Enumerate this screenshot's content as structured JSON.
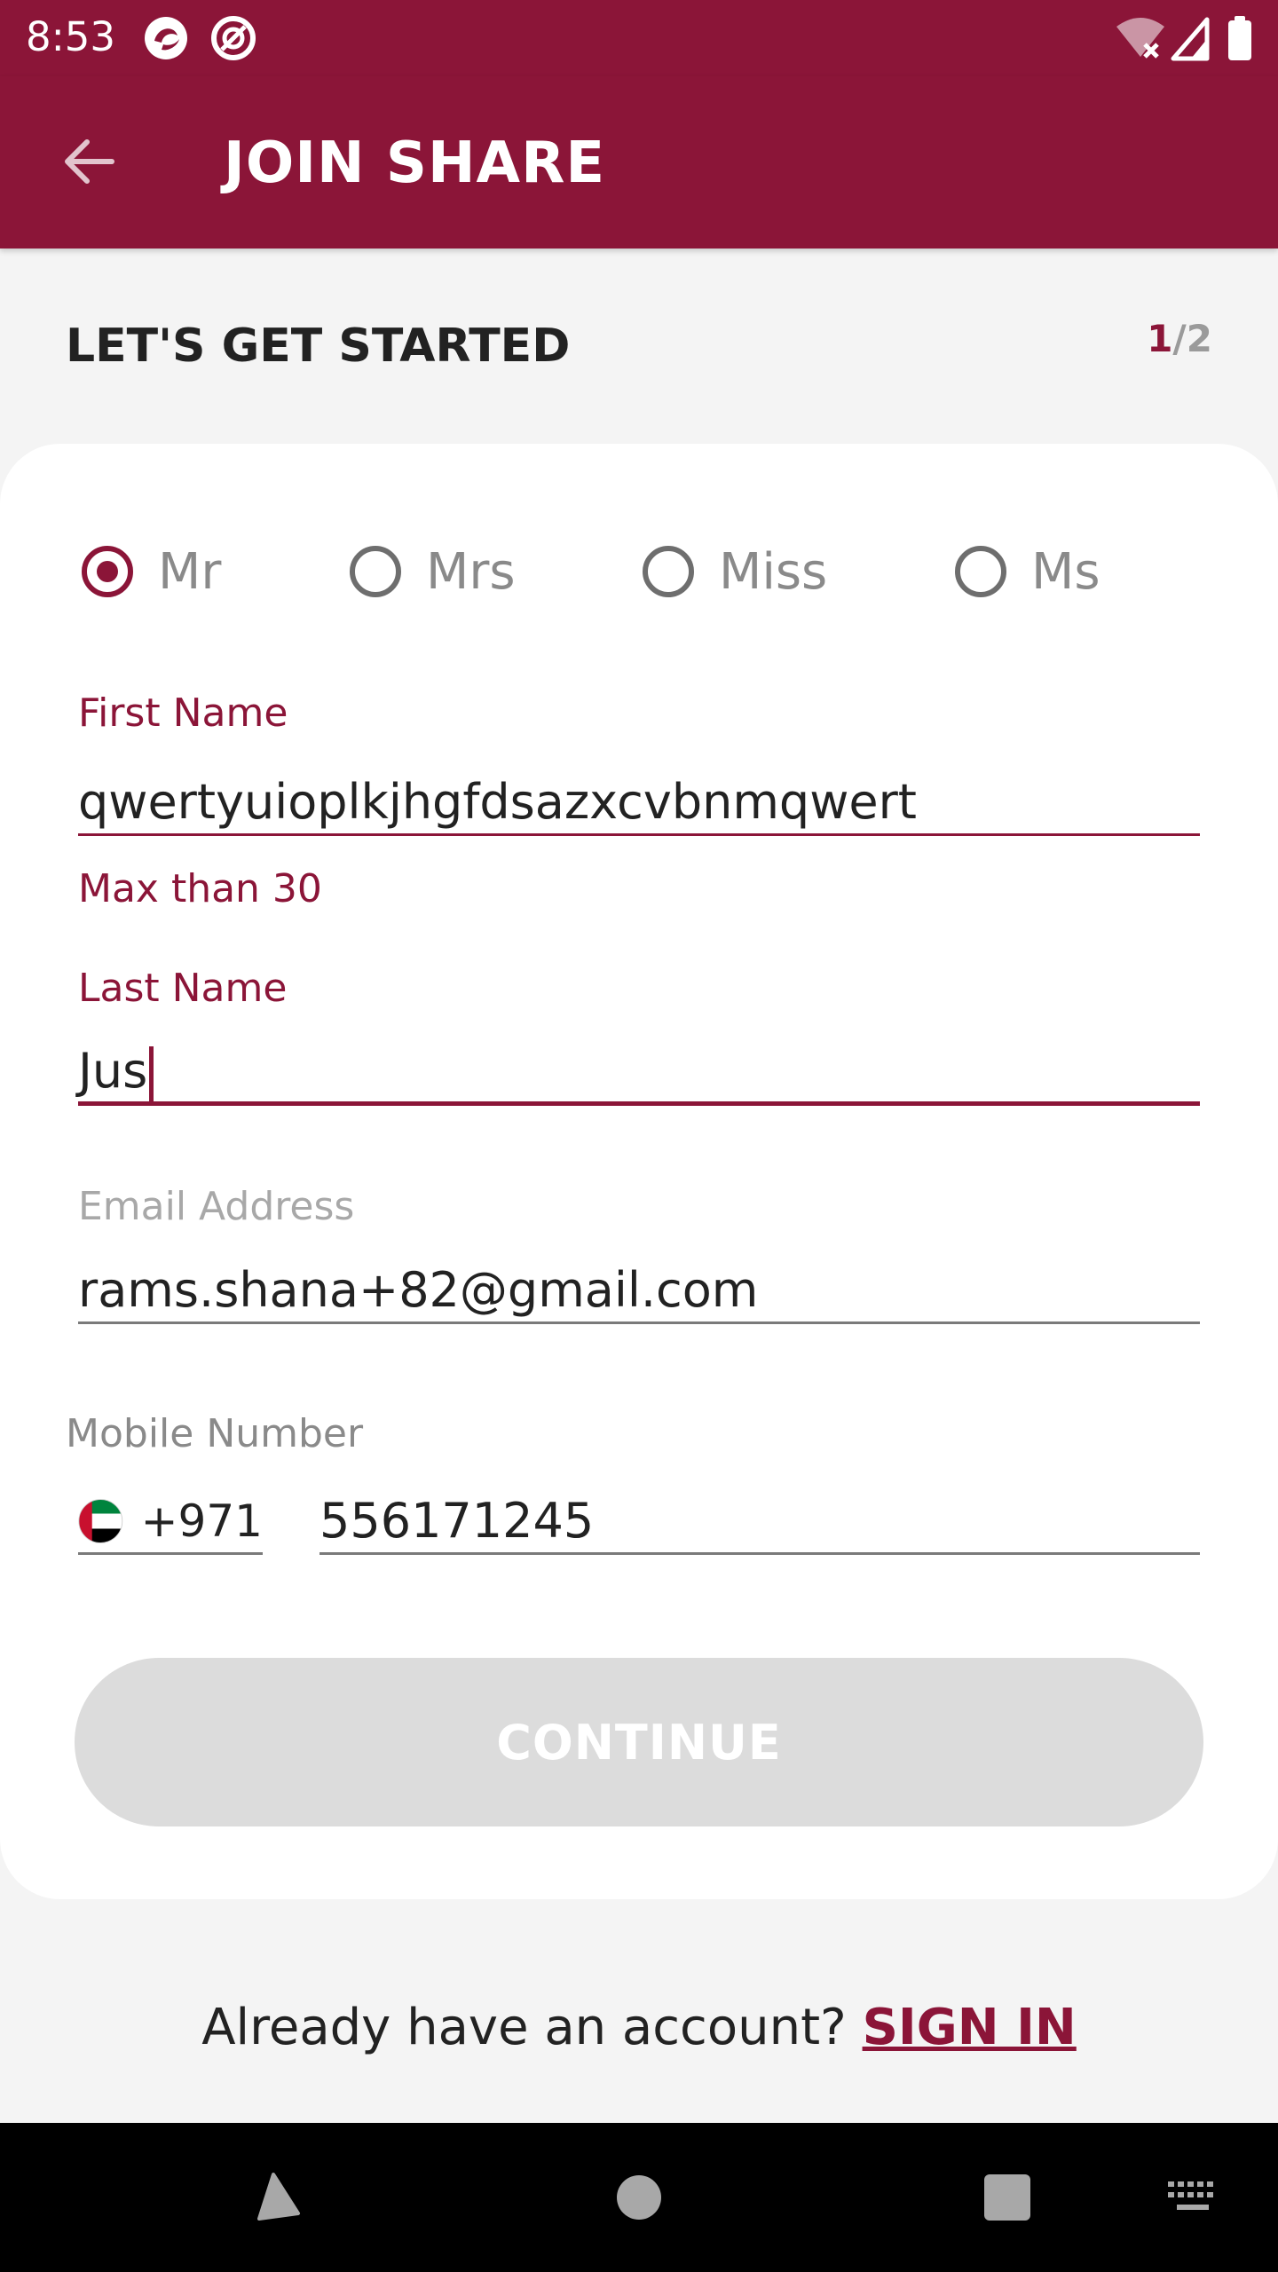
{
  "status_bar": {
    "time": "8:53"
  },
  "app_bar": {
    "title": "JOIN SHARE"
  },
  "section": {
    "title": "LET'S GET STARTED",
    "step_current": "1",
    "step_separator": "/",
    "step_total": "2"
  },
  "form": {
    "titles": [
      {
        "label": "Mr",
        "checked": true
      },
      {
        "label": "Mrs",
        "checked": false
      },
      {
        "label": "Miss",
        "checked": false
      },
      {
        "label": "Ms",
        "checked": false
      }
    ],
    "first_name": {
      "label": "First Name",
      "value": "qwertyuioplkjhgfdsazxcvbnmqwert",
      "error": "Max than 30"
    },
    "last_name": {
      "label": "Last Name",
      "value": "Jus"
    },
    "email": {
      "label": "Email Address",
      "value": "rams.shana+82@gmail.com"
    },
    "mobile": {
      "label": "Mobile Number",
      "dial_code": "+971",
      "value": "556171245"
    },
    "continue_label": "CONTINUE"
  },
  "footer": {
    "prompt": "Already have an account?",
    "signin_label": "SIGN IN"
  },
  "colors": {
    "brand": "#8b1538",
    "disabled_button": "#dcdcdc",
    "background": "#f4f4f4"
  },
  "icons": {
    "back": "arrow-left-icon",
    "wifi": "wifi-off-icon",
    "signal": "cell-signal-icon",
    "battery": "battery-icon",
    "flag": "uae-flag-icon",
    "nav_back": "triangle-back-icon",
    "nav_home": "circle-home-icon",
    "nav_recents": "square-recents-icon",
    "nav_keyboard": "keyboard-icon"
  }
}
